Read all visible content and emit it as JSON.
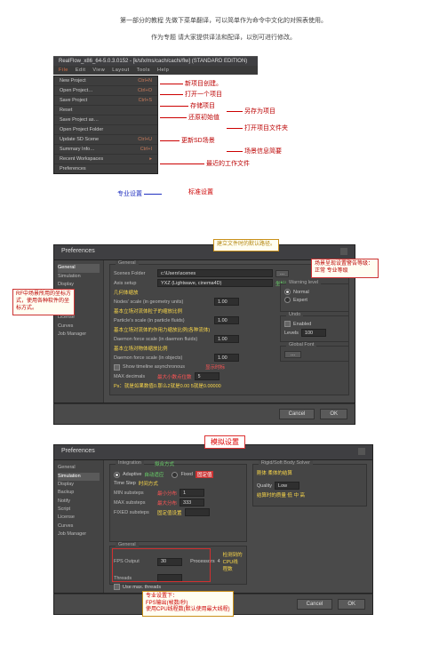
{
  "intro": {
    "line1": "第一部分的教程 先做下菜单翻译，可以简单作为命令中文化的对照表使用。",
    "line2": "作为专题 请大家提供译法和配译，以别可进行修改。"
  },
  "section1": {
    "titlebar": "RealFlow_x86_64-5.0.3.0152 - [k/sfx/ms/cach/cachi/flw] (STANDARD EDITION)",
    "menubar": [
      "File",
      "Edit",
      "View",
      "Layout",
      "Tools",
      "Help"
    ],
    "menu": [
      {
        "label": "New Project",
        "sc": "Ctrl+N"
      },
      {
        "label": "Open Project…",
        "sc": "Ctrl+O"
      },
      {
        "label": "Save Project",
        "sc": "Ctrl+S"
      },
      {
        "label": "Reset",
        "sc": ""
      },
      {
        "label": "Save Project as…",
        "sc": ""
      },
      {
        "label": "Open Project Folder",
        "sc": ""
      },
      {
        "label": "Update SD Scene",
        "sc": "Ctrl+U"
      },
      {
        "label": "Summary Info…",
        "sc": "Ctrl+I"
      },
      {
        "label": "Recent Workspaces",
        "sc": "▸"
      },
      {
        "label": "Preferences",
        "sc": ""
      }
    ],
    "annotations": {
      "new": "新项目创建。",
      "open": "打开一个项目",
      "save": "存储项目",
      "reset": "还原初始值",
      "saveas": "另存为项目",
      "folder": "打开项目文件夹",
      "update": "更新SD场景",
      "summary": "场景信息简要",
      "recent": "最近的工作文件",
      "pref": "专业设置",
      "std": "标准设置"
    }
  },
  "section2": {
    "title": "Preferences",
    "tree": [
      "General",
      "Simulation",
      "Display",
      "Backup",
      "Notify",
      "Script",
      "License",
      "Curves",
      "Job Manager"
    ],
    "general": {
      "scene_folder_label": "Scenes Folder",
      "scene_folder_value": "c:\\Users\\scenes",
      "axis_label": "Axis setup",
      "axis_value": "YXZ (Lightwave, cinema4D)",
      "geom_scale_label": "Nodes' scale (in geometry units)",
      "geom_scale_value": "1.00",
      "particle_scale_label": "Particle's scale (in particle fluids)",
      "particle_scale_value": "1.00",
      "daemon_scale_label": "Daemon force scale (in daemon fluids)",
      "daemon_scale_value": "1.00",
      "daemon_force_scale_label": "Daemon force scale (in objects)",
      "daemon_force_scale_value": "1.00",
      "timeline_label": "Show timeline asynchronous",
      "max_decimals_label": "MAX decimals",
      "max_decimals_value": "5",
      "warning_group": "Warning level",
      "warn_normal": "Normal",
      "warn_expert": "Expert",
      "undo_group": "Undo",
      "undo_enabled": "Enabled",
      "undo_levels_label": "Levels",
      "undo_levels_value": "100",
      "font_group": "Global Font",
      "font_btn": "..."
    },
    "inline": {
      "axis_zh": "坐标轴设定",
      "geom_zh": "几何体缩放",
      "part_zh": "基本立场对流体粒子的缩放比例",
      "daemon_zh": "基本立场对流体的作用力缩放比例(各种流体)",
      "daemon2_zh": "基本立场对物体缩放比例",
      "timeline_zh": "显示时标",
      "max_zh": "最大小数点位数",
      "ps": "Ps：就是如果数值0.那么2就是0.00 5就是0.00000"
    },
    "notes": {
      "path": "建立文件时的默认路径。",
      "axis_box": "RF中场景所用的坐标方式，使用各种软件的坐标方式。",
      "warn_box": "场景呈现设置警告等级：正常  专业等级"
    },
    "btn_cancel": "Cancel",
    "btn_ok": "OK"
  },
  "section3": {
    "title": "Preferences",
    "tag": "模拟设置",
    "tree": [
      "General",
      "Simulation",
      "Display",
      "Backup",
      "Notify",
      "Script",
      "License",
      "Curves",
      "Job Manager"
    ],
    "integration": {
      "group": "Integration",
      "adaptive": "Adaptive",
      "adaptive_zh": "自动适应",
      "fixed": "Fixed",
      "fixed_zh": "固定值",
      "int_zh": "拟合方式",
      "time_zh": "时间方式",
      "time_label": "Time Step",
      "min_label": "MIN substeps",
      "min_zh": "最小分布",
      "min_value": "1",
      "max_label": "MAX substeps",
      "max_zh": "最大分布",
      "max_value": "333",
      "fixed_sub_label": "FIXED substeps",
      "fixed_sub_zh": "固定值设置",
      "fixed_sub_value": ""
    },
    "rigid": {
      "group": "Rigid/Soft Body Solver",
      "group2": "刚体 柔体的结算",
      "quality_label": "Quality",
      "quality_value": "Low",
      "quality_zh": "结算时的质量 低 中 高"
    },
    "gen": {
      "group": "General",
      "fps_label": "FPS Output",
      "fps_value": "30",
      "threads_label": "Threads",
      "threads_value": "",
      "procs_label": "Processors",
      "procs_value": "4",
      "procs_zh": "检测到的CPU线程数",
      "usemax": "Use max. threads"
    },
    "notes": {
      "box": "专业设置下：\nFPS输出(帧数/秒)\n使用CPU线程数(默认使用最大线程)"
    },
    "btn_cancel": "Cancel",
    "btn_ok": "OK"
  }
}
